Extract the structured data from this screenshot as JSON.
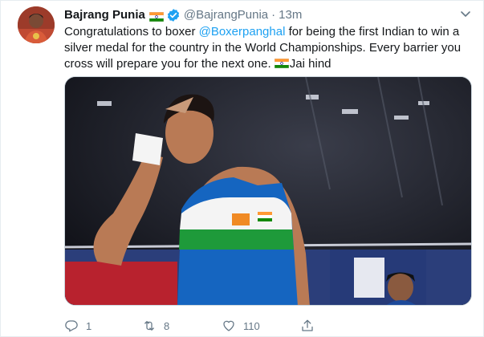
{
  "tweet": {
    "author_name": "Bajrang Punia",
    "handle": "@BajrangPunia",
    "separator": "·",
    "time": "13m",
    "text_part1": "Congratulations to boxer ",
    "mention": "@Boxerpanghal",
    "text_part2": " for being the first Indian to win a silver medal for the country in the World Championships. Every barrier you cross will prepare you for the next one. ",
    "text_part3": "Jai hind"
  },
  "actions": {
    "reply_count": "1",
    "retweet_count": "8",
    "like_count": "110"
  },
  "icons": {
    "flag": "india-flag-icon",
    "verified": "verified-badge-icon",
    "more": "chevron-down-icon",
    "reply": "reply-icon",
    "retweet": "retweet-icon",
    "like": "heart-icon",
    "share": "share-icon"
  },
  "colors": {
    "link": "#1da1f2",
    "muted": "#657786",
    "text": "#14171a",
    "border": "#e6ecf0"
  }
}
